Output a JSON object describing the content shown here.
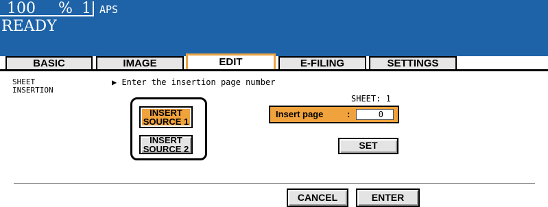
{
  "status": {
    "zoom": "100",
    "percent_sign": "%",
    "copies": "1",
    "paper": "APS",
    "state": "READY"
  },
  "tabs": [
    {
      "label": "BASIC"
    },
    {
      "label": "IMAGE"
    },
    {
      "label": "EDIT"
    },
    {
      "label": "E-FILING"
    },
    {
      "label": "SETTINGS"
    }
  ],
  "active_tab": "EDIT",
  "panel": {
    "title_line1": "SHEET",
    "title_line2": "INSERTION",
    "instruction": "▶ Enter the insertion page number",
    "sheet_label": "SHEET: 1",
    "insert_page_label": "Insert page",
    "insert_page_colon": ":",
    "insert_page_value": "0"
  },
  "sources": [
    {
      "line1": "INSERT",
      "line2": "SOURCE 1",
      "selected": true
    },
    {
      "line1": "INSERT",
      "line2": "SOURCE 2",
      "selected": false
    }
  ],
  "buttons": {
    "set": "SET",
    "cancel": "CANCEL",
    "enter": "ENTER"
  },
  "colors": {
    "header_blue": "#1e63a8",
    "accent_orange": "#f0a23c"
  }
}
